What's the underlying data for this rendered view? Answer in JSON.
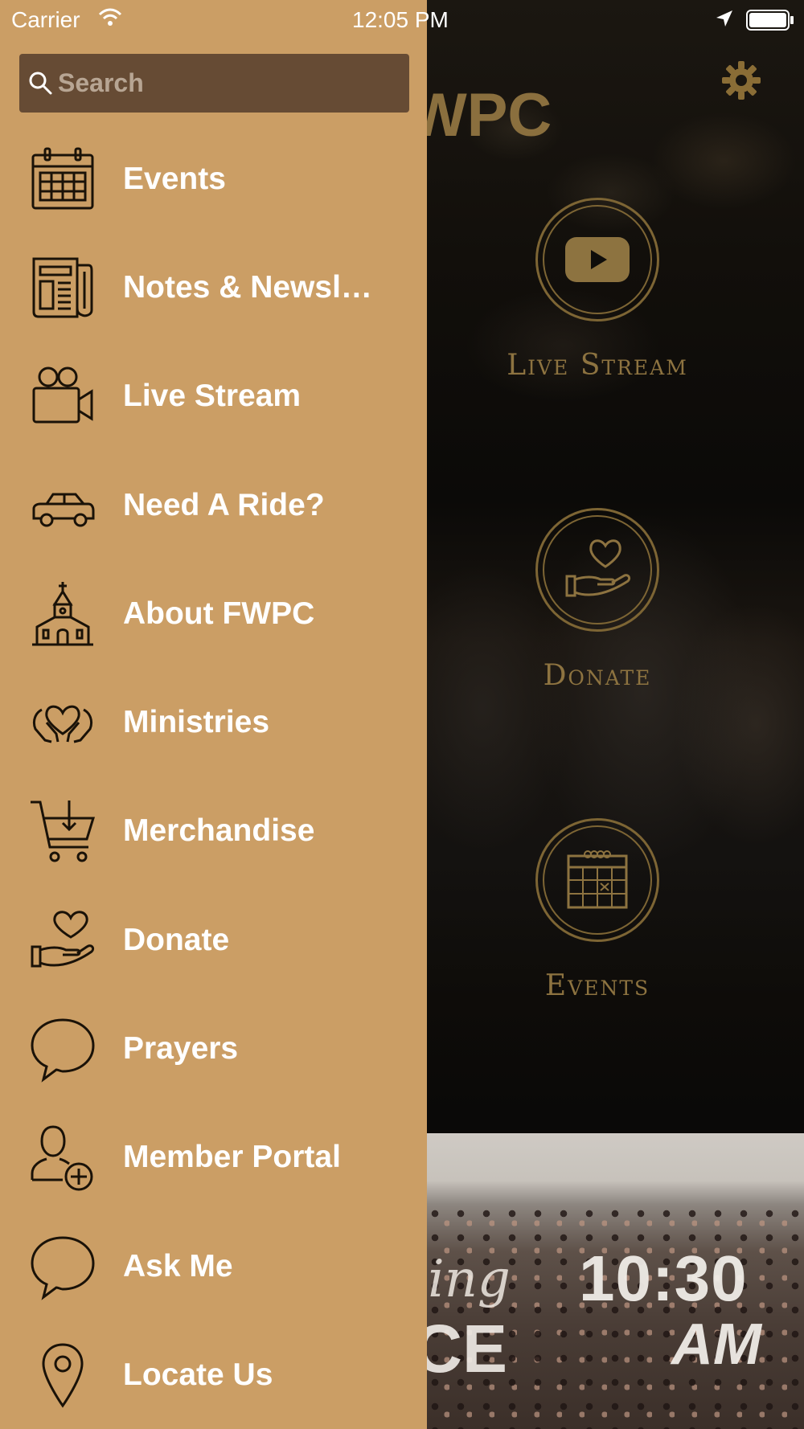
{
  "status_bar": {
    "carrier": "Carrier",
    "time": "12:05 PM"
  },
  "search": {
    "placeholder": "Search",
    "value": ""
  },
  "menu": {
    "items": [
      {
        "label": "Events",
        "icon": "calendar-icon"
      },
      {
        "label": "Notes & Newsletters",
        "icon": "newspaper-icon"
      },
      {
        "label": "Live Stream",
        "icon": "video-camera-icon"
      },
      {
        "label": "Need A Ride?",
        "icon": "car-icon"
      },
      {
        "label": "About FWPC",
        "icon": "church-icon"
      },
      {
        "label": "Ministries",
        "icon": "heart-hands-icon"
      },
      {
        "label": "Merchandise",
        "icon": "cart-icon"
      },
      {
        "label": "Donate",
        "icon": "donate-hand-heart-icon"
      },
      {
        "label": "Prayers",
        "icon": "speech-bubble-icon"
      },
      {
        "label": "Member Portal",
        "icon": "add-user-icon"
      },
      {
        "label": "Ask Me",
        "icon": "speech-bubble-icon"
      },
      {
        "label": "Locate Us",
        "icon": "map-pin-icon"
      }
    ]
  },
  "background": {
    "app_title_partial": "WPC",
    "features": [
      {
        "label": "Live Stream",
        "icon": "youtube-play-icon"
      },
      {
        "label": "Donate",
        "icon": "hand-heart-icon"
      },
      {
        "label": "Events",
        "icon": "calendar-icon"
      }
    ],
    "service": {
      "script_partial": "ning",
      "word_partial": "ICE",
      "time": "10:30",
      "meridiem": "AM"
    }
  },
  "colors": {
    "drawer": "#cb9e65",
    "search_bg": "#664b34",
    "accent_gold": "#8d7340",
    "text_white": "#ffffff"
  }
}
